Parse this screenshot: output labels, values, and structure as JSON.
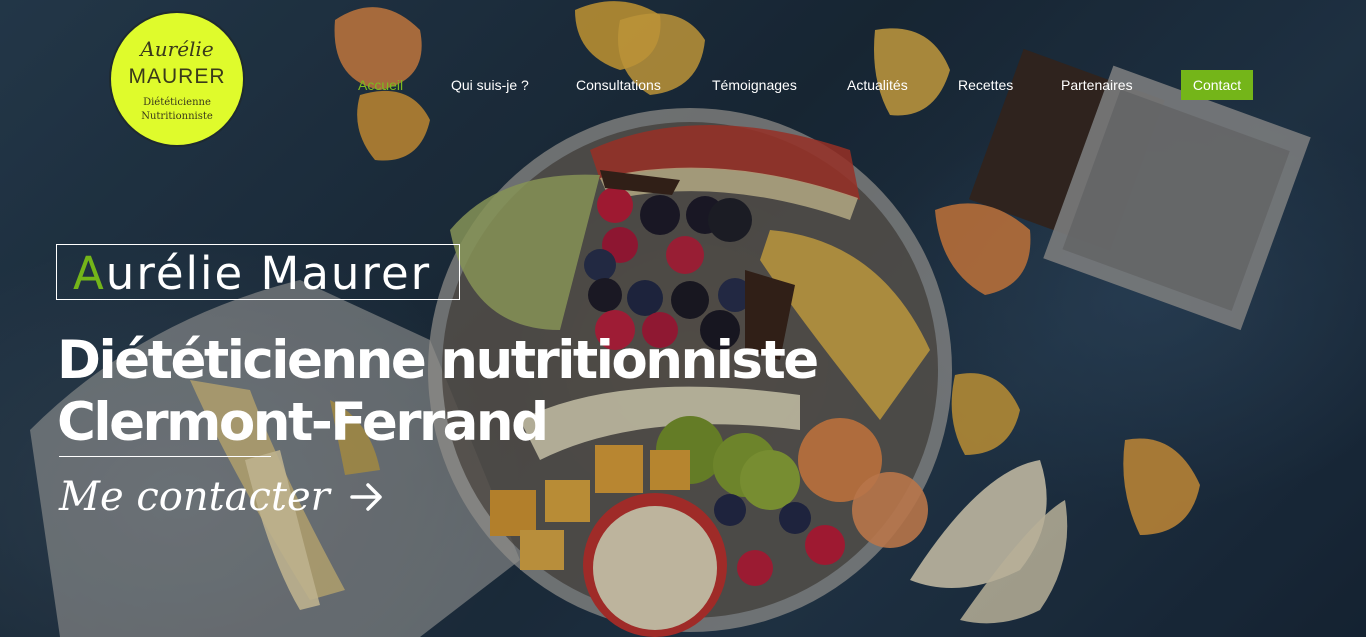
{
  "logo": {
    "first_name": "Aurélie",
    "last_name": "MAURER",
    "subtitle_line1": "Diététicienne",
    "subtitle_line2": "Nutritionniste"
  },
  "nav": {
    "items": [
      {
        "label": "Accueil",
        "active": true
      },
      {
        "label": "Qui suis-je ?"
      },
      {
        "label": "Consultations"
      },
      {
        "label": "Témoignages"
      },
      {
        "label": "Actualités"
      },
      {
        "label": "Recettes"
      },
      {
        "label": "Partenaires"
      }
    ],
    "cta_label": "Contact"
  },
  "hero": {
    "name_initial": "A",
    "name_rest": "urélie Maurer",
    "headline_line1": "Diététicienne nutritionniste",
    "headline_line2": "Clermont-Ferrand",
    "contact_label": "Me contacter",
    "background": "fruit-platter-photo",
    "arrow_icon": "arrow-right-icon"
  },
  "colors": {
    "accent_green": "#74b519",
    "logo_yellow": "#dffb2c",
    "text_white": "#ffffff"
  }
}
